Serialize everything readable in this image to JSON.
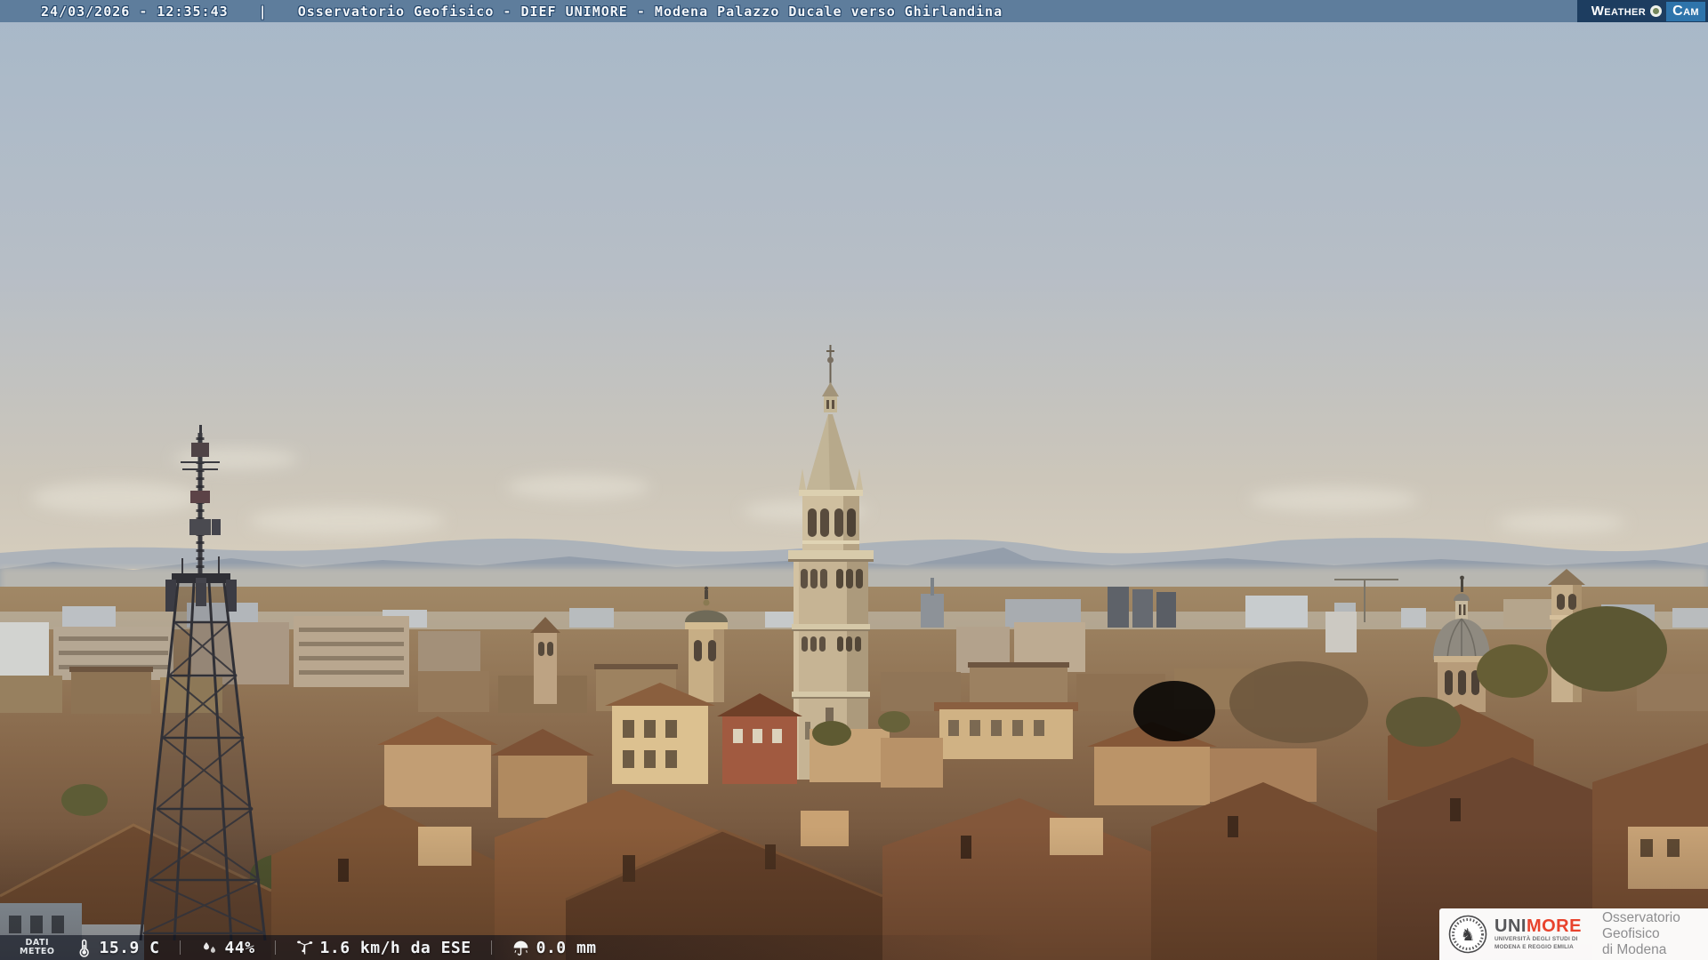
{
  "top_bar": {
    "datetime": "24/03/2026 - 12:35:43",
    "separator": "|",
    "title": "Osservatorio Geofisico - DIEF UNIMORE - Modena Palazzo Ducale verso Ghirlandina",
    "bar_color": "#5e7d9c",
    "weathercam": {
      "weather_label": "Weather",
      "cam_label": "Cam",
      "badge_bg": "#1d3d60",
      "cam_box_bg": "#2e74ab",
      "dot_icon": "camera-lens-dot-icon"
    }
  },
  "weather_bar": {
    "label_line1": "DATI",
    "label_line2": "METEO",
    "items": [
      {
        "icon": "thermometer-icon",
        "value": "15.9 C"
      },
      {
        "icon": "humidity-drops-icon",
        "value": "44%"
      },
      {
        "icon": "anemometer-icon",
        "value": "1.6 km/h da ESE"
      },
      {
        "icon": "rain-umbrella-icon",
        "value": "0.0 mm"
      }
    ]
  },
  "logo_panel": {
    "seal_icon": "unimore-equestrian-seal-icon",
    "wordmark_uni": "UNI",
    "wordmark_more": "MORE",
    "wordmark_more_color": "#e8432d",
    "university_line1": "UNIVERSITÀ DEGLI STUDI DI",
    "university_line2": "MODENA E REGGIO EMILIA",
    "org_line1": "Osservatorio Geofisico",
    "org_line2": "di Modena"
  }
}
